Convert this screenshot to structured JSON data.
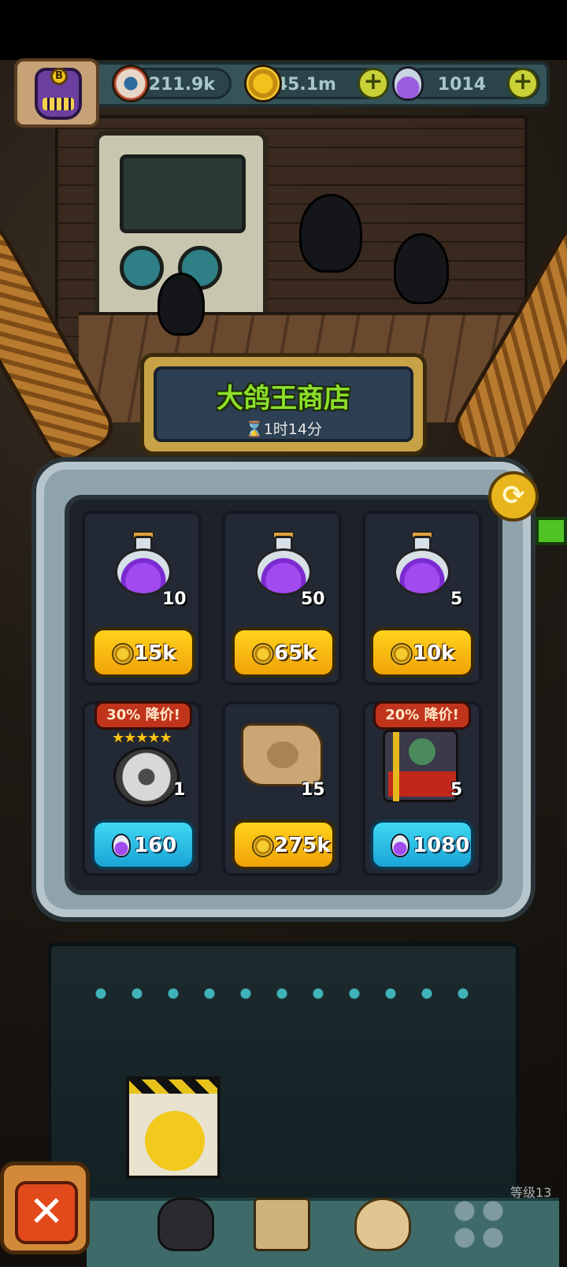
{
  "resources": {
    "eyes": "211.9k",
    "coins": "45.1m",
    "potions": "1014"
  },
  "avatar": {
    "badge": "B"
  },
  "shop": {
    "title": "大鸽王商店",
    "timer": "1时14分",
    "items": [
      {
        "name": "purple-potion",
        "amount": "10",
        "price": "15k",
        "currency": "coin"
      },
      {
        "name": "purple-potion",
        "amount": "50",
        "price": "65k",
        "currency": "coin"
      },
      {
        "name": "purple-potion",
        "amount": "5",
        "price": "10k",
        "currency": "coin"
      },
      {
        "name": "rune-orb",
        "amount": "1",
        "price": "160",
        "currency": "potion",
        "discount": "30% 降价!",
        "stars": "★★★★★"
      },
      {
        "name": "treasure-map",
        "amount": "15",
        "price": "275k",
        "currency": "coin"
      },
      {
        "name": "robot-fighter",
        "amount": "5",
        "price": "1080",
        "currency": "potion",
        "discount": "20% 降价!"
      }
    ]
  },
  "footer": {
    "level": "等级13",
    "close": "✕"
  },
  "colors": {
    "title_green": "#8ce02a",
    "gold_button": "#ffd21c",
    "blue_button": "#3fd8f2",
    "discount_red": "#c0341c"
  }
}
